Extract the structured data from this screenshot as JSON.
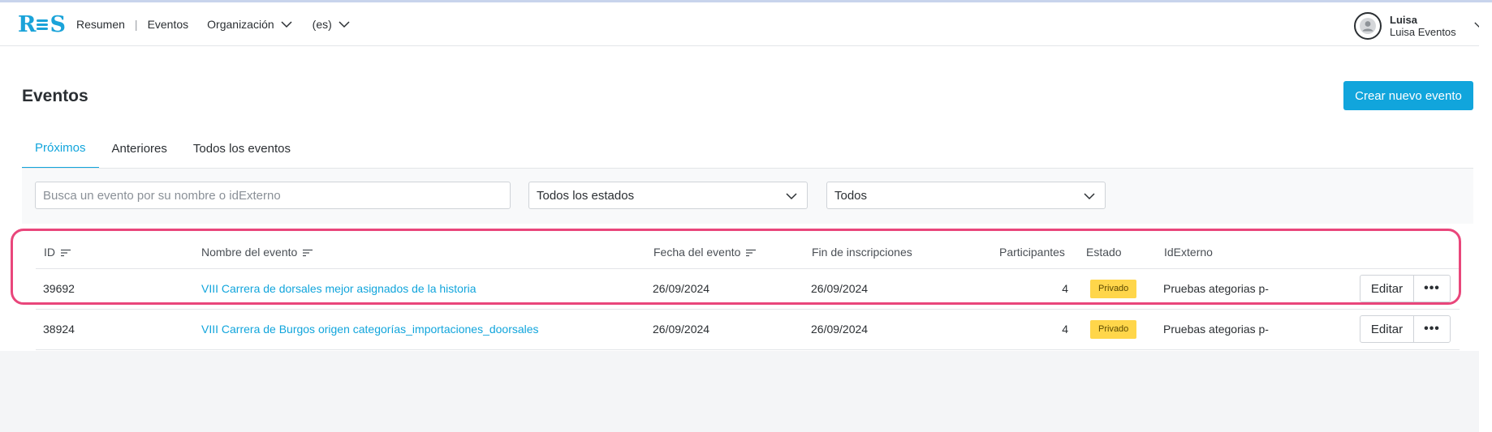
{
  "header": {
    "logo": {
      "left": "R",
      "right": "S"
    },
    "nav": [
      {
        "label": "Resumen"
      },
      {
        "label": "Eventos"
      },
      {
        "label": "Organización"
      },
      {
        "label": "(es)"
      }
    ],
    "user": {
      "name": "Luisa",
      "org": "Luisa Eventos"
    }
  },
  "page": {
    "title": "Eventos",
    "create_button": "Crear nuevo evento"
  },
  "tabs": [
    {
      "label": "Próximos",
      "active": true
    },
    {
      "label": "Anteriores",
      "active": false
    },
    {
      "label": "Todos los eventos",
      "active": false
    }
  ],
  "filters": {
    "search_placeholder": "Busca un evento por su nombre o idExterno",
    "search_value": "",
    "status_select": "Todos los estados",
    "type_select": "Todos"
  },
  "table": {
    "columns": {
      "id": "ID",
      "name": "Nombre del evento",
      "date": "Fecha del evento",
      "registration_end": "Fin de inscripciones",
      "participants": "Participantes",
      "status": "Estado",
      "external_id": "IdExterno"
    },
    "rows": [
      {
        "id": "39692",
        "name": "VIII Carrera de dorsales mejor asignados de la historia",
        "date": "26/09/2024",
        "registration_end": "26/09/2024",
        "participants": "4",
        "status": "Privado",
        "external_id": "Pruebas ategorias p-",
        "edit": "Editar",
        "more": "•••"
      },
      {
        "id": "38924",
        "name": "VIII Carrera de Burgos origen categorías_importaciones_doorsales",
        "date": "26/09/2024",
        "registration_end": "26/09/2024",
        "participants": "4",
        "status": "Privado",
        "external_id": "Pruebas ategorias p-",
        "edit": "Editar",
        "more": "•••"
      }
    ]
  },
  "colors": {
    "accent": "#11a5dc",
    "badge": "#ffd64a",
    "highlight": "#e9467b"
  }
}
